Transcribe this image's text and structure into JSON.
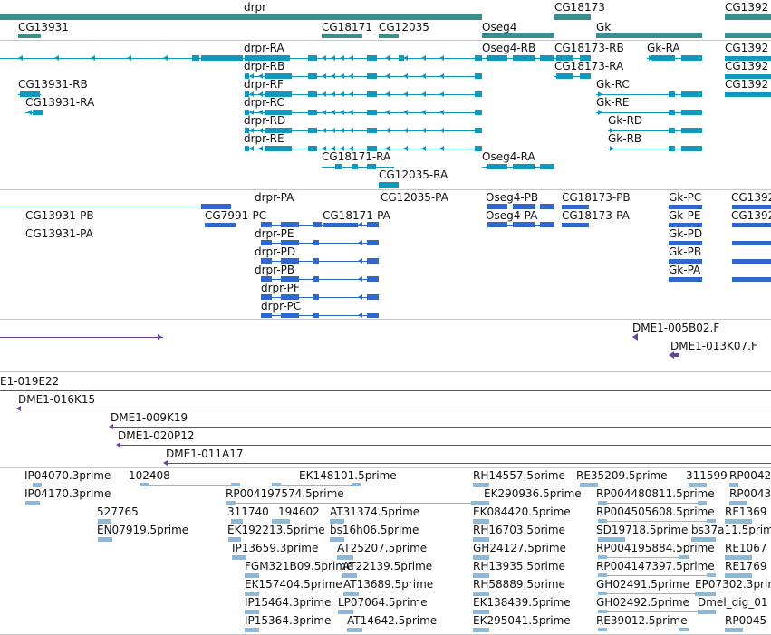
{
  "tracks": {
    "gene_spans": [
      "drpr",
      "CG13931",
      "CG18171",
      "CG12035",
      "Oseg4",
      "CG18173",
      "Gk",
      "CG1392"
    ],
    "annotation_transcripts": [
      "drpr-RA",
      "drpr-RB",
      "drpr-RF",
      "drpr-RC",
      "drpr-RD",
      "drpr-RE",
      "CG13931-RB",
      "CG13931-RA",
      "Oseg4-RB",
      "Oseg4-RA",
      "CG18173-RB",
      "CG18173-RA",
      "Gk-RA",
      "Gk-RC",
      "Gk-RE",
      "Gk-RD",
      "Gk-RB",
      "CG1392",
      "CG1392",
      "CG1392",
      "CG18171-RA",
      "CG12035-RA"
    ],
    "protein_features": [
      "drpr-PA",
      "CG12035-PA",
      "Oseg4-PB",
      "CG18173-PB",
      "Gk-PC",
      "CG1392",
      "CG13931-PB",
      "CG7991-PC",
      "CG18171-PA",
      "Oseg4-PA",
      "CG18173-PA",
      "Gk-PE",
      "CG1392",
      "CG13931-PA",
      "drpr-PE",
      "Gk-PD",
      "drpr-PD",
      "Gk-PB",
      "drpr-PB",
      "Gk-PA",
      "drpr-PF",
      "drpr-PC"
    ],
    "bac_ends_upper": [
      "DME1-005B02.F",
      "DME1-013K07.F"
    ],
    "bac_clones": [
      "E1-019E22",
      "DME1-016K15",
      "DME1-009K19",
      "DME1-020P12",
      "DME1-011A17"
    ],
    "ests": [
      "IP04070.3prime",
      "102408",
      "EK148101.5prime",
      "RH14557.5prime",
      "RE35209.5prime",
      "311599",
      "RP0042",
      "IP04170.3prime",
      "RP004197574.5prime",
      "EK290936.5prime",
      "RP004480811.5prime",
      "RP0043",
      "527765",
      "311740",
      "194602",
      "AT31374.5prime",
      "EK084420.5prime",
      "RP004505608.5prime",
      "RE1369",
      "EN07919.5prime",
      "EK192213.5prime",
      "bs16h06.5prime",
      "RH16703.5prime",
      "SD19718.5prime",
      "bs37a11.5prim",
      "IP13659.3prime",
      "AT25207.5prime",
      "GH24127.5prime",
      "RP004195884.5prime",
      "RE1067",
      "FGM321B09.5prime",
      "AT22139.5prime",
      "RH13935.5prime",
      "RP004147397.5prime",
      "RE1769",
      "EK157404.5prime",
      "AT13689.5prime",
      "RH58889.5prime",
      "GH02491.5prime",
      "EP07302.3prime",
      "IP15464.3prime",
      "LP07064.5prime",
      "EK138439.5prime",
      "GH02492.5prime",
      "Dmel_dig_01",
      "IP15364.3prime",
      "AT14642.5prime",
      "EK295041.5prime",
      "RE39012.5prime",
      "RP0045"
    ]
  },
  "colors": {
    "gene": "#3a8e8e",
    "transcript": "#1199bb",
    "protein": "#3366cc",
    "clone": "#664499",
    "est": "#8ab9d9"
  }
}
